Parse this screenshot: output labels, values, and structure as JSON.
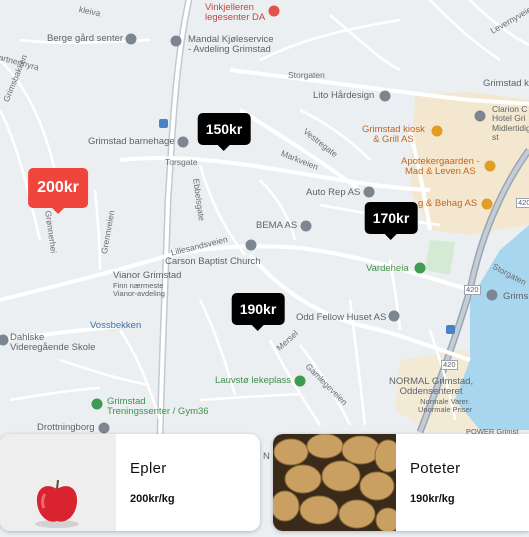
{
  "map": {
    "places": {
      "vinkjelleren": "Vinkjelleren\nlegesenter DA",
      "berge": "Berge gård senter",
      "mandal": "Mandal Kjøleservice\n- Avdeling Grimstad",
      "storgaten": "Storgaten",
      "lito": "Lito Hårdesign",
      "grimstad_kirke": "Grimstad kir",
      "clarion": "Clarion C\nHotel Gri\nMidlertidig st",
      "grimstad_barnehage": "Grimstad barnehage",
      "kiosk": "Grimstad kiosk\n& Grill AS",
      "apotek": "Apotekergaarden -\nMad & Leven AS",
      "behag": "g & Behag AS",
      "autorep": "Auto Rep AS",
      "bema": "BEMA AS",
      "carson": "Carson Baptist Church",
      "vianor": "Vianor Grimstad",
      "vianor_sub": "Finn nærmeste\nVianor-avdeling",
      "vardeheia": "Vardeheia",
      "grims_right": "Grims",
      "dahlske": "Dahlske\nVideregående Skole",
      "vossbekken": "Vossbekken",
      "oddfellow": "Odd Fellow Huset AS",
      "lauvsto": "Lauvstø lekeplass",
      "normal": "NORMAL Grimstad,\nOddensenteret",
      "normal_sub": "Normale Varer.\nUnormale Priser",
      "treningssenter": "Grimstad\nTreningssenter / Gym36",
      "drottningborg": "Drottningborg",
      "power": "POWER Grimst",
      "n_label": "N"
    },
    "streets": {
      "torsgate": "Torsgate",
      "ebbelsgate": "Ebbelsgate",
      "vestregate": "Vestregate",
      "markveien": "Markveien",
      "lillesandsveien": "Lillesandsveien",
      "mersel": "Mersel",
      "gamlegeveien": "Gamlegeveien",
      "grennerhei": "Grønnerhei",
      "grennveien": "Grennveien",
      "artnermyra": "artnermyra",
      "grimsbakken": "Grimsbakken",
      "kleiva": "kleiva",
      "levernyveien": "Levernyveien",
      "storgaten_r": "Storgaten",
      "road420a": "420",
      "road420b": "420",
      "road420c": "420"
    },
    "icon_colors": {
      "gray": "#7d8590",
      "green": "#3f9a52",
      "orange": "#e39c26",
      "blue": "#4a83c4",
      "red": "#e0524a"
    }
  },
  "markers": [
    {
      "label": "150kr",
      "selected": false
    },
    {
      "label": "200kr",
      "selected": true
    },
    {
      "label": "170kr",
      "selected": false
    },
    {
      "label": "190kr",
      "selected": false
    }
  ],
  "products": [
    {
      "name": "Epler",
      "price": "200kr/kg",
      "image": "apple-photo"
    },
    {
      "name": "Poteter",
      "price": "190kr/kg",
      "image": "potatoes-photo"
    }
  ],
  "colors": {
    "accent": "#f0453b",
    "marker": "#000000",
    "water": "#a9d6ef",
    "park": "#c9e8c9",
    "commercial": "#f6e6c3"
  }
}
